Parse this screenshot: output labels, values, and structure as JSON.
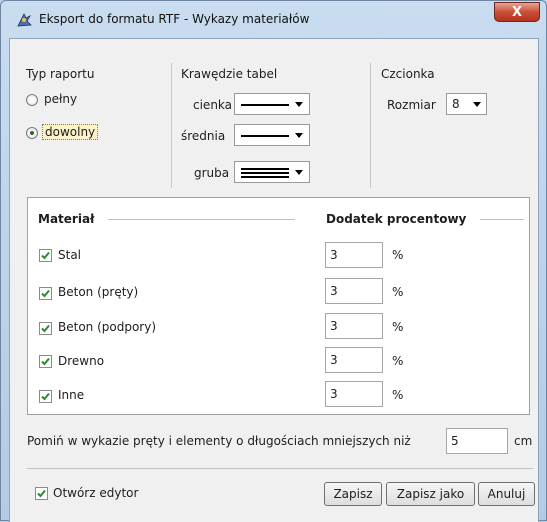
{
  "window": {
    "title": "Eksport do formatu RTF - Wykazy materiałów",
    "close_label": "X"
  },
  "report_type": {
    "label": "Typ raportu",
    "options": [
      {
        "label": "pełny",
        "selected": false
      },
      {
        "label": "dowolny",
        "selected": true
      }
    ]
  },
  "table_borders": {
    "label": "Krawędzie tabel",
    "rows": [
      {
        "label": "cienka",
        "line": "single-thin"
      },
      {
        "label": "średnia",
        "line": "single-medium"
      },
      {
        "label": "gruba",
        "line": "triple"
      }
    ]
  },
  "font": {
    "label": "Czcionka",
    "size_label": "Rozmiar",
    "size_value": "8"
  },
  "materials": {
    "col_material": "Materiał",
    "col_percent": "Dodatek procentowy",
    "unit": "%",
    "rows": [
      {
        "name": "Stal",
        "checked": true,
        "value": "3"
      },
      {
        "name": "Beton (pręty)",
        "checked": true,
        "value": "3"
      },
      {
        "name": "Beton (podpory)",
        "checked": true,
        "value": "3"
      },
      {
        "name": "Drewno",
        "checked": true,
        "value": "3"
      },
      {
        "name": "Inne",
        "checked": true,
        "value": "3"
      }
    ]
  },
  "omit": {
    "label": "Pomiń w wykazie pręty i elementy o długościach mniejszych niż",
    "value": "5",
    "unit": "cm"
  },
  "open_editor": {
    "label": "Otwórz edytor",
    "checked": true
  },
  "buttons": {
    "save": "Zapisz",
    "save_as": "Zapisz jako",
    "cancel": "Anuluj"
  },
  "colors": {
    "check": "#2f8a2f",
    "close": "#c75038",
    "frame": "#b9d1ea"
  }
}
